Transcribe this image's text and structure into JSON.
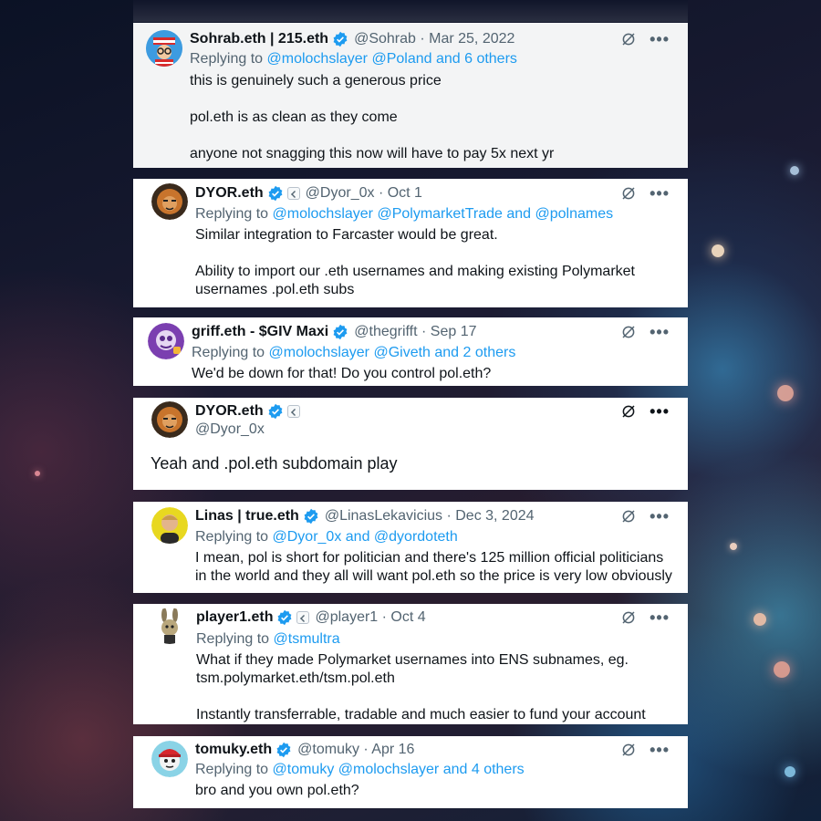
{
  "colors": {
    "link": "#1d9bf0",
    "verified": "#1d9bf0",
    "muted": "#536471",
    "text": "#0f1419"
  },
  "tweets": [
    {
      "name": "Sohrab.eth | 215.eth",
      "handle": "@Sohrab",
      "date": "Mar 25, 2022",
      "handle_date": "@Sohrab · Mar 25, 2022",
      "replying_prefix": "Replying to ",
      "replying_links": "@molochslayer @Poland and 6 others",
      "text": "this is genuinely such a generous price\n\npol.eth is as clean as they come\n\nanyone not snagging this now will have to pay 5x next yr",
      "avatar": "waldo-avatar"
    },
    {
      "name": "DYOR.eth",
      "handle_date": "@Dyor_0x · Oct 1",
      "replying_prefix": "Replying to ",
      "replying_links": "@molochslayer @PolymarketTrade and @polnames",
      "text": "Similar integration to Farcaster would be great.\n\nAbility to import our .eth usernames and making existing Polymarket usernames .pol.eth subs",
      "avatar": "lion-avatar"
    },
    {
      "name": "griff.eth - $GIV Maxi",
      "handle_date": "@thegrifft · Sep 17",
      "replying_prefix": "Replying to ",
      "replying_links": "@molochslayer @Giveth and 2 others",
      "text": "We'd be down for that! Do you control pol.eth?",
      "avatar": "purple-avatar"
    },
    {
      "name": "DYOR.eth",
      "handle": "@Dyor_0x",
      "text": "Yeah and .pol.eth subdomain play",
      "avatar": "lion-avatar"
    },
    {
      "name": "Linas | true.eth",
      "handle_date": "@LinasLekavicius · Dec 3, 2024",
      "replying_prefix": "Replying to ",
      "replying_links": "@Dyor_0x and @dyordoteth",
      "text": "I mean, pol is short for politician and there's 125 million official politicians in the world and they all will want pol.eth so the price is very low obviously",
      "avatar": "photo-avatar"
    },
    {
      "name": "player1.eth",
      "handle_date": "@player1 · Oct 4",
      "replying_prefix": "Replying to ",
      "replying_links": "@tsmultra",
      "text": "What if they made Polymarket usernames into ENS subnames, eg.\ntsm.polymarket.eth/tsm.pol.eth\n\nInstantly transferrable, tradable and much easier to fund your account",
      "avatar": "bunny-avatar"
    },
    {
      "name": "tomuky.eth",
      "handle_date": "@tomuky · Apr 16",
      "replying_prefix": "Replying to ",
      "replying_links": "@tomuky @molochslayer and 4 others",
      "text": "bro and you own pol.eth?",
      "avatar": "capped-avatar"
    }
  ]
}
